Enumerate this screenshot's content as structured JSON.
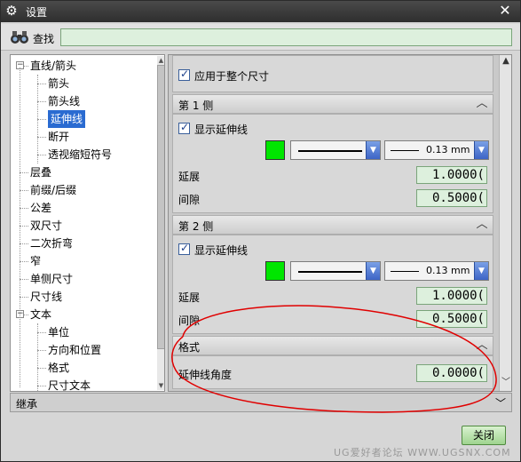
{
  "window": {
    "title": "设置",
    "close_glyph": "✕"
  },
  "search": {
    "label": "查找",
    "value": "",
    "placeholder": ""
  },
  "tree": {
    "items": [
      {
        "label": "直线/箭头",
        "level": 0,
        "expanded": true
      },
      {
        "label": "箭头",
        "level": 1
      },
      {
        "label": "箭头线",
        "level": 1
      },
      {
        "label": "延伸线",
        "level": 1,
        "selected": true
      },
      {
        "label": "断开",
        "level": 1
      },
      {
        "label": "透视缩短符号",
        "level": 1
      },
      {
        "label": "层叠",
        "level": 0
      },
      {
        "label": "前缀/后缀",
        "level": 0
      },
      {
        "label": "公差",
        "level": 0
      },
      {
        "label": "双尺寸",
        "level": 0
      },
      {
        "label": "二次折弯",
        "level": 0
      },
      {
        "label": "窄",
        "level": 0
      },
      {
        "label": "单侧尺寸",
        "level": 0
      },
      {
        "label": "尺寸线",
        "level": 0
      },
      {
        "label": "文本",
        "level": 0,
        "expanded": true
      },
      {
        "label": "单位",
        "level": 1
      },
      {
        "label": "方向和位置",
        "level": 1
      },
      {
        "label": "格式",
        "level": 1
      },
      {
        "label": "尺寸文本",
        "level": 1
      }
    ]
  },
  "inherit": {
    "label": "继承"
  },
  "panel": {
    "apply_whole": {
      "label": "应用于整个尺寸",
      "checked": true
    },
    "side1": {
      "header": "第 1 侧",
      "show_ext": {
        "label": "显示延伸线",
        "checked": true
      },
      "color": "#00e600",
      "width_text": "0.13 mm",
      "extend_label": "延展",
      "extend_value": "1.0000(",
      "gap_label": "间隙",
      "gap_value": "0.5000("
    },
    "side2": {
      "header": "第 2 侧",
      "show_ext": {
        "label": "显示延伸线",
        "checked": true
      },
      "color": "#00e600",
      "width_text": "0.13 mm",
      "extend_label": "延展",
      "extend_value": "1.0000(",
      "gap_label": "间隙",
      "gap_value": "0.5000("
    },
    "format": {
      "header": "格式",
      "angle_label": "延伸线角度",
      "angle_value": "0.0000("
    }
  },
  "footer": {
    "close_label": "关闭"
  },
  "watermark": "UG爱好者论坛 WWW.UGSNX.COM",
  "colors": {
    "accent": "#2a6bd1",
    "field_bg": "#ddf0dd",
    "annotation": "#e00000"
  },
  "icons": {
    "settings": "gear-icon",
    "search": "binoculars-icon",
    "collapse": "chevron-up-icon",
    "dropdown": "chevron-down-icon"
  }
}
